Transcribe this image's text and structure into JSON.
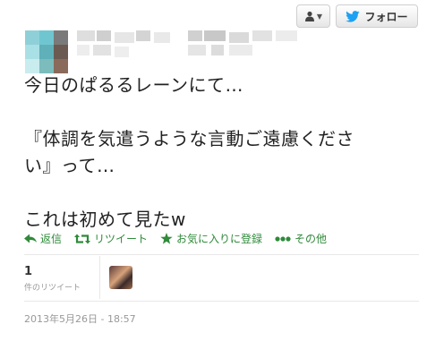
{
  "header": {
    "follow_label": "フォロー",
    "user_menu_icon": "user-icon",
    "bird_icon": "twitter-bird-icon"
  },
  "tweet": {
    "lines": [
      "今日のぱるるレーンにて…",
      "",
      "『体調を気遣うような言動ご遠慮くださ",
      "い』って…",
      "",
      "これは初めて見たw"
    ]
  },
  "actions": [
    {
      "label": "返信",
      "icon": "reply-icon"
    },
    {
      "label": "リツイート",
      "icon": "retweet-icon"
    },
    {
      "label": "お気に入りに登録",
      "icon": "star-icon"
    },
    {
      "label": "その他",
      "icon": "more-icon"
    }
  ],
  "stats": {
    "retweet_count": "1",
    "retweet_label": "件のリツイート"
  },
  "timestamp": "2013年5月26日 - 18:57",
  "colors": {
    "action_green": "#2f8a3a",
    "bird_blue": "#1da1f2"
  }
}
